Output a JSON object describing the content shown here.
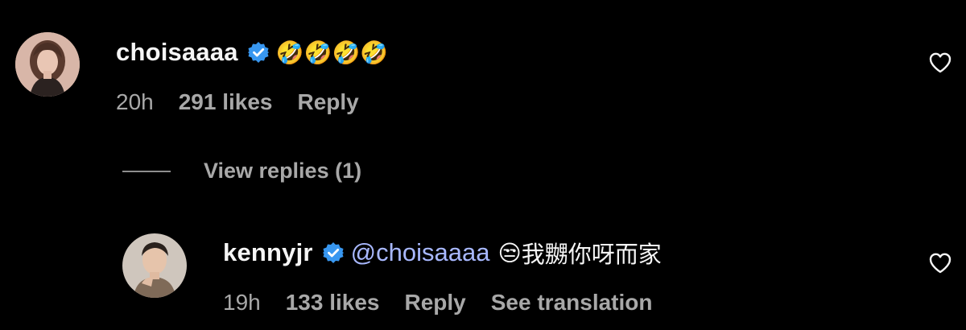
{
  "colors": {
    "background": "#000000",
    "primary_text": "#f5f5f5",
    "secondary_text": "#a8a8a8",
    "verified_badge": "#3897f0",
    "mention": "#a8b8ff"
  },
  "comments": [
    {
      "username": "choisaaaa",
      "verified": true,
      "verified_icon": "verified-badge-icon",
      "mention": "",
      "emoji": "🤣🤣🤣🤣",
      "text": "",
      "time": "20h",
      "likes": "291 likes",
      "reply_label": "Reply",
      "translation_label": "",
      "like_icon": "heart-outline-icon",
      "avatar_icon": "avatar-photo-woman"
    },
    {
      "username": "kennyjr",
      "verified": true,
      "verified_icon": "verified-badge-icon",
      "mention": "@choisaaaa",
      "emoji": "😒",
      "text": "我嬲你呀而家",
      "time": "19h",
      "likes": "133 likes",
      "reply_label": "Reply",
      "translation_label": "See translation",
      "like_icon": "heart-outline-icon",
      "avatar_icon": "avatar-photo-man"
    }
  ],
  "view_replies": {
    "label": "View replies (1)"
  }
}
